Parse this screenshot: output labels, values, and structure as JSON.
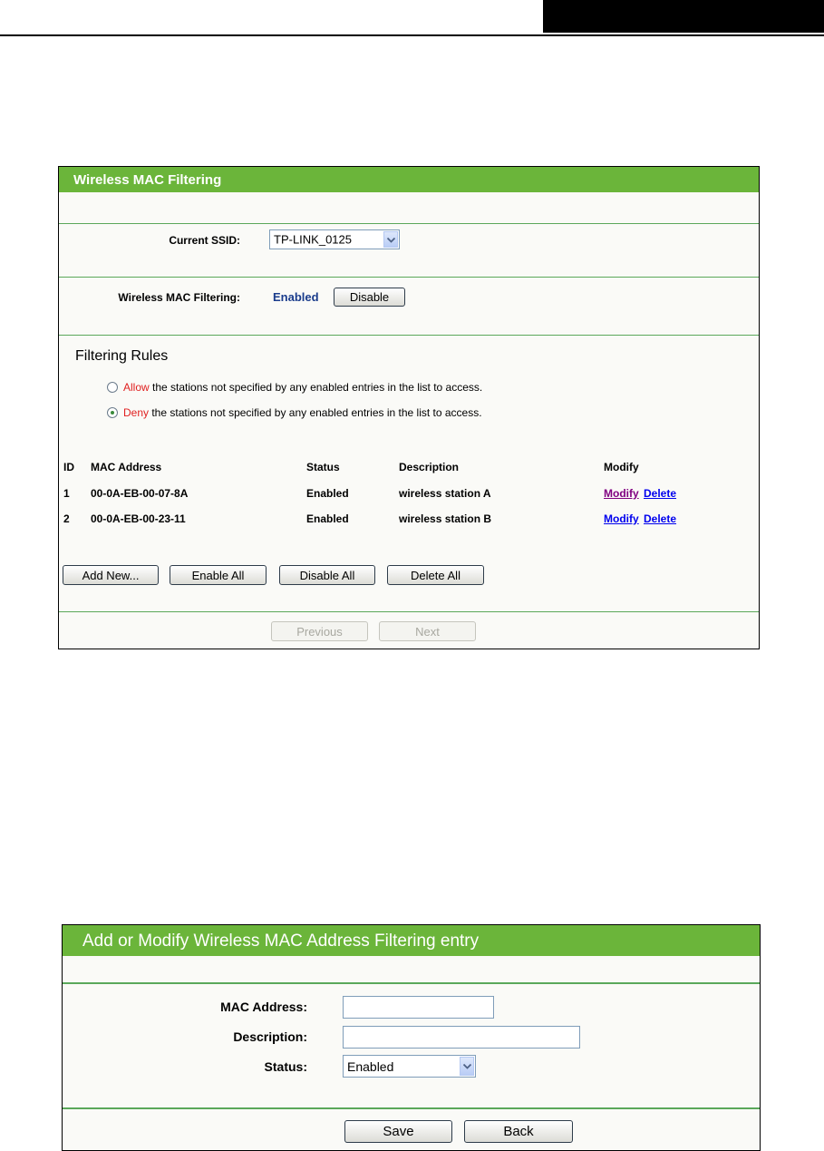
{
  "mac_filter_panel": {
    "title": "Wireless MAC Filtering",
    "ssid_label": "Current SSID:",
    "ssid_value": "TP-LINK_0125",
    "filtering_label": "Wireless MAC Filtering:",
    "filtering_status": "Enabled",
    "disable_button": "Disable",
    "rules_heading": "Filtering Rules",
    "rule_allow_keyword": "Allow",
    "rule_allow_text": " the stations not specified by any enabled entries in the list to access.",
    "rule_deny_keyword": "Deny",
    "rule_deny_text": " the stations not specified by any enabled entries in the list to access.",
    "selected_rule": "Deny",
    "table": {
      "headers": [
        "ID",
        "MAC Address",
        "Status",
        "Description",
        "Modify"
      ],
      "rows": [
        {
          "id": "1",
          "mac": "00-0A-EB-00-07-8A",
          "status": "Enabled",
          "description": "wireless station A",
          "modify": "Modify",
          "delete": "Delete"
        },
        {
          "id": "2",
          "mac": "00-0A-EB-00-23-11",
          "status": "Enabled",
          "description": "wireless station B",
          "modify": "Modify",
          "delete": "Delete"
        }
      ]
    },
    "buttons": {
      "add_new": "Add New...",
      "enable_all": "Enable All",
      "disable_all": "Disable All",
      "delete_all": "Delete All",
      "previous": "Previous",
      "next": "Next"
    }
  },
  "entry_panel": {
    "title": "Add or Modify Wireless MAC Address Filtering entry",
    "mac_label": "MAC Address:",
    "mac_value": "",
    "description_label": "Description:",
    "description_value": "",
    "status_label": "Status:",
    "status_value": "Enabled",
    "save_button": "Save",
    "back_button": "Back"
  },
  "colors": {
    "title_bar": "#6bb53a",
    "divider": "#5aa85a",
    "keyword_red": "#e02020",
    "enabled_blue": "#1a3c8c",
    "link_visited": "#800080",
    "link_unvisited": "#0000ee"
  }
}
